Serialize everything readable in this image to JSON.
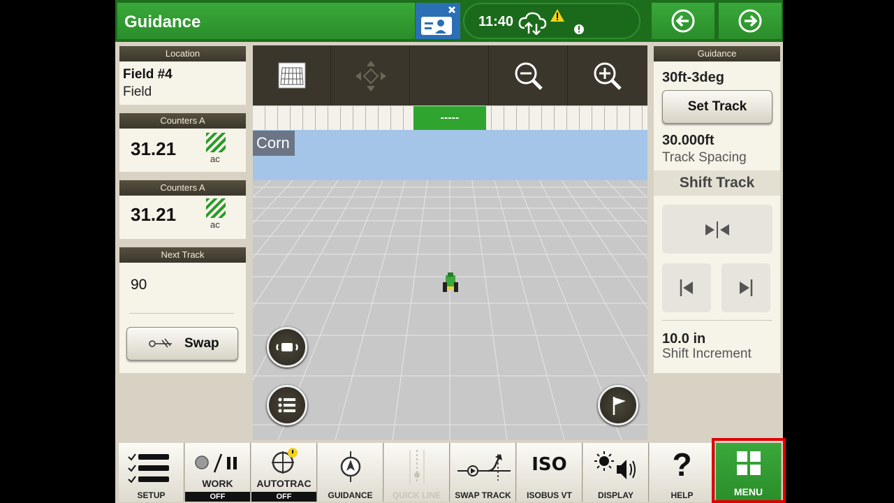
{
  "header": {
    "title": "Guidance",
    "time": "11:40"
  },
  "left": {
    "location": {
      "head": "Location",
      "field": "Field #4",
      "type": "Field"
    },
    "counter1": {
      "head": "Counters A",
      "value": "31.21",
      "unit": "ac"
    },
    "counter2": {
      "head": "Counters A",
      "value": "31.21",
      "unit": "ac"
    },
    "next_track": {
      "head": "Next Track",
      "value": "90",
      "swap_label": "Swap"
    }
  },
  "map": {
    "crop_label": "Corn",
    "lightbar_value": "-----"
  },
  "right": {
    "head": "Guidance",
    "track_name": "30ft-3deg",
    "set_track_label": "Set Track",
    "spacing_value": "30.000ft",
    "spacing_label": "Track Spacing",
    "shift_title": "Shift Track",
    "increment_value": "10.0 in",
    "increment_label": "Shift Increment"
  },
  "bottom": [
    {
      "id": "setup",
      "label": "SETUP"
    },
    {
      "id": "work",
      "label": "WORK",
      "state": "OFF"
    },
    {
      "id": "autotrac",
      "label": "AUTOTRAC",
      "state": "OFF"
    },
    {
      "id": "guidance",
      "label": "GUIDANCE"
    },
    {
      "id": "quickline",
      "label": "QUICK LINE"
    },
    {
      "id": "swaptrack",
      "label": "SWAP TRACK"
    },
    {
      "id": "isobus",
      "label": "ISOBUS VT",
      "icon_text": "ISO"
    },
    {
      "id": "display",
      "label": "DISPLAY"
    },
    {
      "id": "help",
      "label": "HELP",
      "icon_text": "?"
    },
    {
      "id": "menu",
      "label": "MENU"
    }
  ],
  "colors": {
    "accent": "#2a8e2a",
    "highlight": "#e00000",
    "panel_head": "#3b372c"
  }
}
